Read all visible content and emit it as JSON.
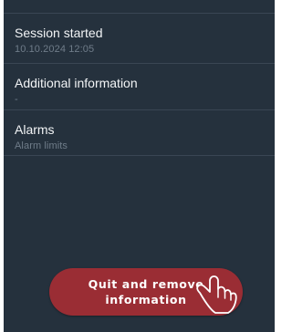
{
  "session": {
    "title": "Session started",
    "value": "10.10.2024 12:05"
  },
  "additional_info": {
    "title": "Additional information",
    "value": "-"
  },
  "alarms": {
    "title": "Alarms",
    "value": "Alarm limits"
  },
  "quit_button": {
    "line1": "Quit and remove",
    "line2": "information"
  },
  "colors": {
    "background": "#25313d",
    "button": "#9a2d34",
    "text_primary": "#f2f4f6",
    "text_secondary": "#6f7c89"
  },
  "icons": {
    "cursor": "pointing-hand-icon"
  }
}
